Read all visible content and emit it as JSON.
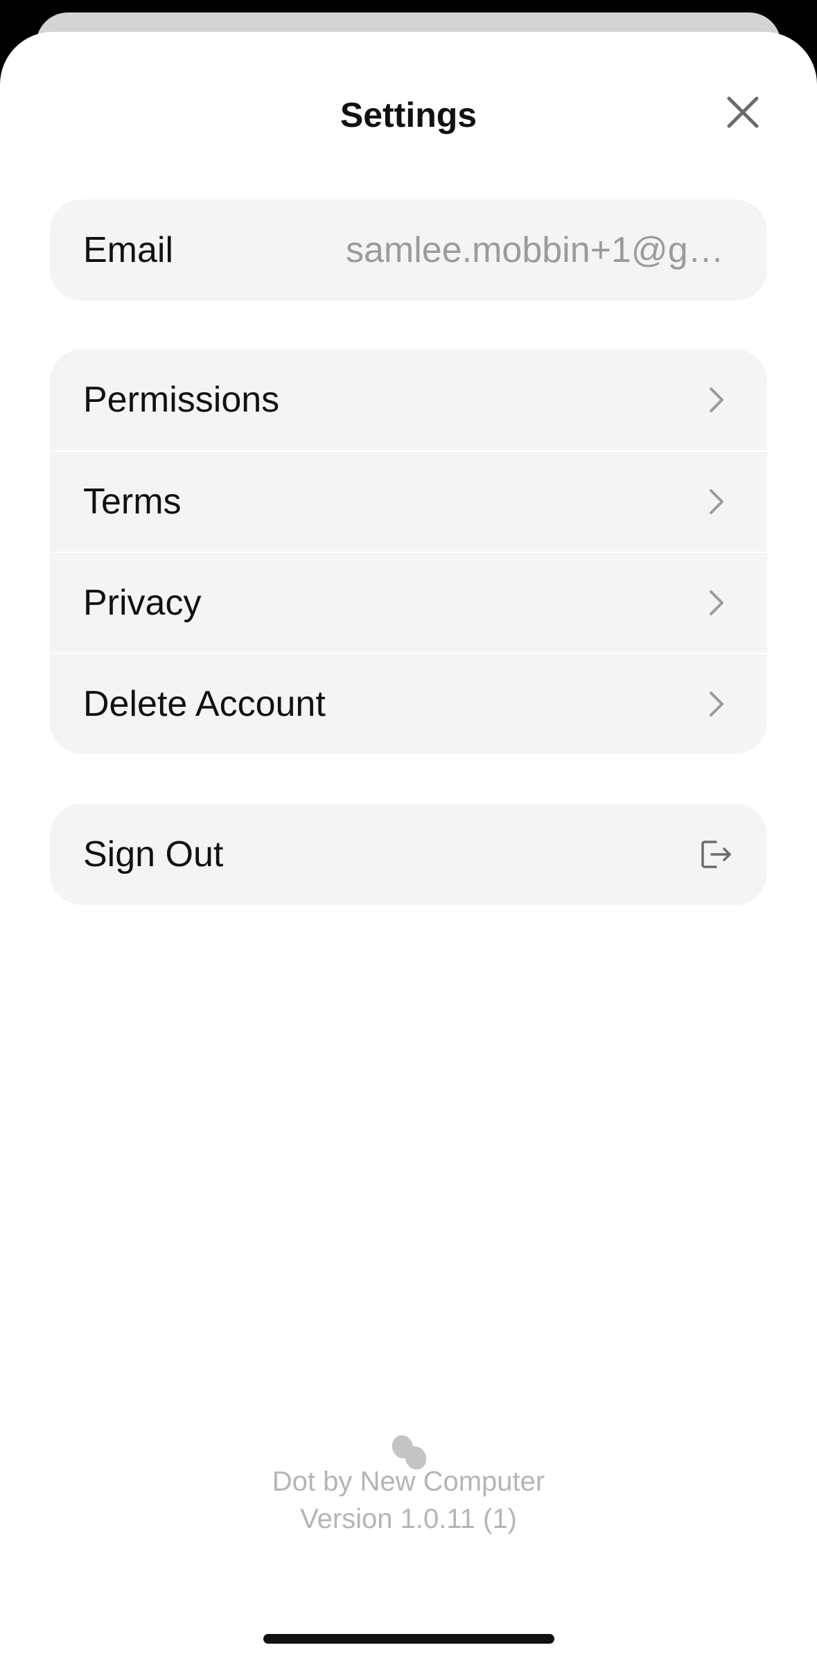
{
  "header": {
    "title": "Settings"
  },
  "account": {
    "email_label": "Email",
    "email_value": "samlee.mobbin+1@gm..."
  },
  "menu": {
    "items": [
      {
        "label": "Permissions"
      },
      {
        "label": "Terms"
      },
      {
        "label": "Privacy"
      },
      {
        "label": "Delete Account"
      }
    ]
  },
  "signout": {
    "label": "Sign Out"
  },
  "footer": {
    "app_name": "Dot by New Computer",
    "version": "Version 1.0.11 (1)"
  },
  "icons": {
    "close": "close-icon",
    "chevron": "chevron-right-icon",
    "sign_out": "sign-out-icon",
    "logo": "dot-logo-icon"
  },
  "colors": {
    "card_bg": "#f4f4f4",
    "secondary_text": "#9b9b9b",
    "footer_text": "#b5b5b5"
  }
}
